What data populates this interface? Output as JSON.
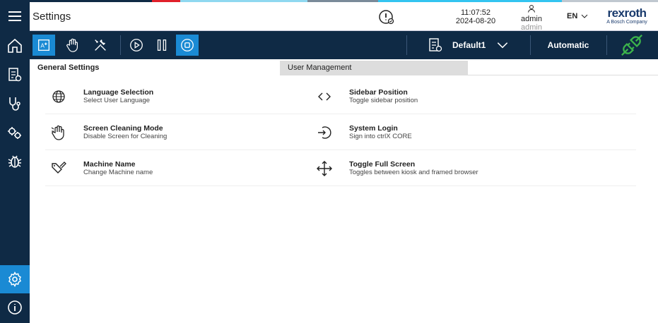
{
  "colors": {
    "sidebar_bg": "#0f2a45",
    "accent_blue": "#1a8ad4",
    "connected_green": "#3cb44b",
    "strip": [
      "#0f2a45",
      "#e0202a",
      "#8fd8f0",
      "#7a8a99",
      "#33c4f0",
      "#c0c8d0"
    ]
  },
  "header": {
    "title": "Settings",
    "time": "11:07:52",
    "date": "2024-08-20",
    "user_name": "admin",
    "user_role": "admin",
    "language": "EN",
    "brand_name": "rexroth",
    "brand_tagline": "A Bosch Company"
  },
  "toolbar": {
    "profile_name": "Default1",
    "mode_label": "Automatic"
  },
  "tabs": [
    {
      "label": "General Settings",
      "active": true
    },
    {
      "label": "User Management",
      "active": false
    }
  ],
  "settings": {
    "language": {
      "title": "Language Selection",
      "subtitle": "Select User Language",
      "icon": "globe-icon"
    },
    "sidebar": {
      "title": "Sidebar Position",
      "subtitle": "Toggle sidebar position",
      "icon": "code-brackets-icon"
    },
    "cleaning": {
      "title": "Screen Cleaning Mode",
      "subtitle": "Disable Screen for Cleaning",
      "icon": "hand-touch-icon"
    },
    "login": {
      "title": "System Login",
      "subtitle": "Sign into ctrlX CORE",
      "icon": "login-icon"
    },
    "machine": {
      "title": "Machine Name",
      "subtitle": "Change Machine name",
      "icon": "tag-edit-icon"
    },
    "fullscreen": {
      "title": "Toggle Full Screen",
      "subtitle": "Toggles between kiosk and framed browser",
      "icon": "move-arrows-icon"
    }
  }
}
